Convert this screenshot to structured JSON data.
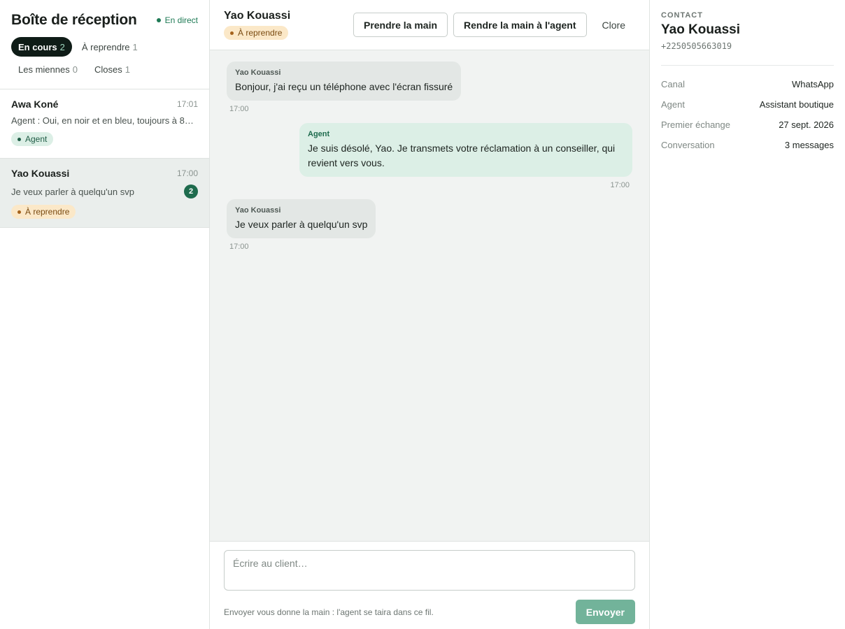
{
  "sidebar": {
    "title": "Boîte de réception",
    "live_label": "En direct",
    "filters": [
      {
        "label": "En cours",
        "count": "2"
      },
      {
        "label": "À reprendre",
        "count": "1"
      },
      {
        "label": "Les miennes",
        "count": "0"
      },
      {
        "label": "Closes",
        "count": "1"
      }
    ],
    "conversations": [
      {
        "name": "Awa Koné",
        "time": "17:01",
        "preview": "Agent : Oui, en noir et en bleu, toujours à 8…",
        "badge": "Agent"
      },
      {
        "name": "Yao Kouassi",
        "time": "17:00",
        "preview": "Je veux parler à quelqu'un svp",
        "unread": "2",
        "badge": "À reprendre"
      }
    ]
  },
  "chat": {
    "contact_name": "Yao Kouassi",
    "status_badge": "À reprendre",
    "actions": {
      "take": "Prendre la main",
      "return": "Rendre la main à l'agent",
      "close": "Clore"
    },
    "messages": [
      {
        "sender": "Yao Kouassi",
        "text": "Bonjour, j'ai reçu un téléphone avec l'écran fissuré",
        "time": "17:00"
      },
      {
        "sender": "Agent",
        "text": "Je suis désolé, Yao. Je transmets votre réclamation à un conseiller, qui revient vers vous.",
        "time": "17:00"
      },
      {
        "sender": "Yao Kouassi",
        "text": "Je veux parler à quelqu'un svp",
        "time": "17:00"
      }
    ],
    "composer": {
      "placeholder": "Écrire au client…",
      "value": "",
      "hint": "Envoyer vous donne la main : l'agent se taira dans ce fil.",
      "send_label": "Envoyer"
    }
  },
  "details": {
    "kicker": "CONTACT",
    "name": "Yao Kouassi",
    "phone": "+2250505663019",
    "rows": [
      {
        "label": "Canal",
        "value": "WhatsApp"
      },
      {
        "label": "Agent",
        "value": "Assistant boutique"
      },
      {
        "label": "Premier échange",
        "value": "27 sept. 2026"
      },
      {
        "label": "Conversation",
        "value": "3 messages"
      }
    ]
  },
  "colors": {
    "accent": "#1e6b4d",
    "agent_bubble": "#dcefe6",
    "client_bubble": "#e3e7e5",
    "retake_badge": "#fbe8c8",
    "send_button": "#72b39a",
    "active_filter": "#0f1c17"
  }
}
